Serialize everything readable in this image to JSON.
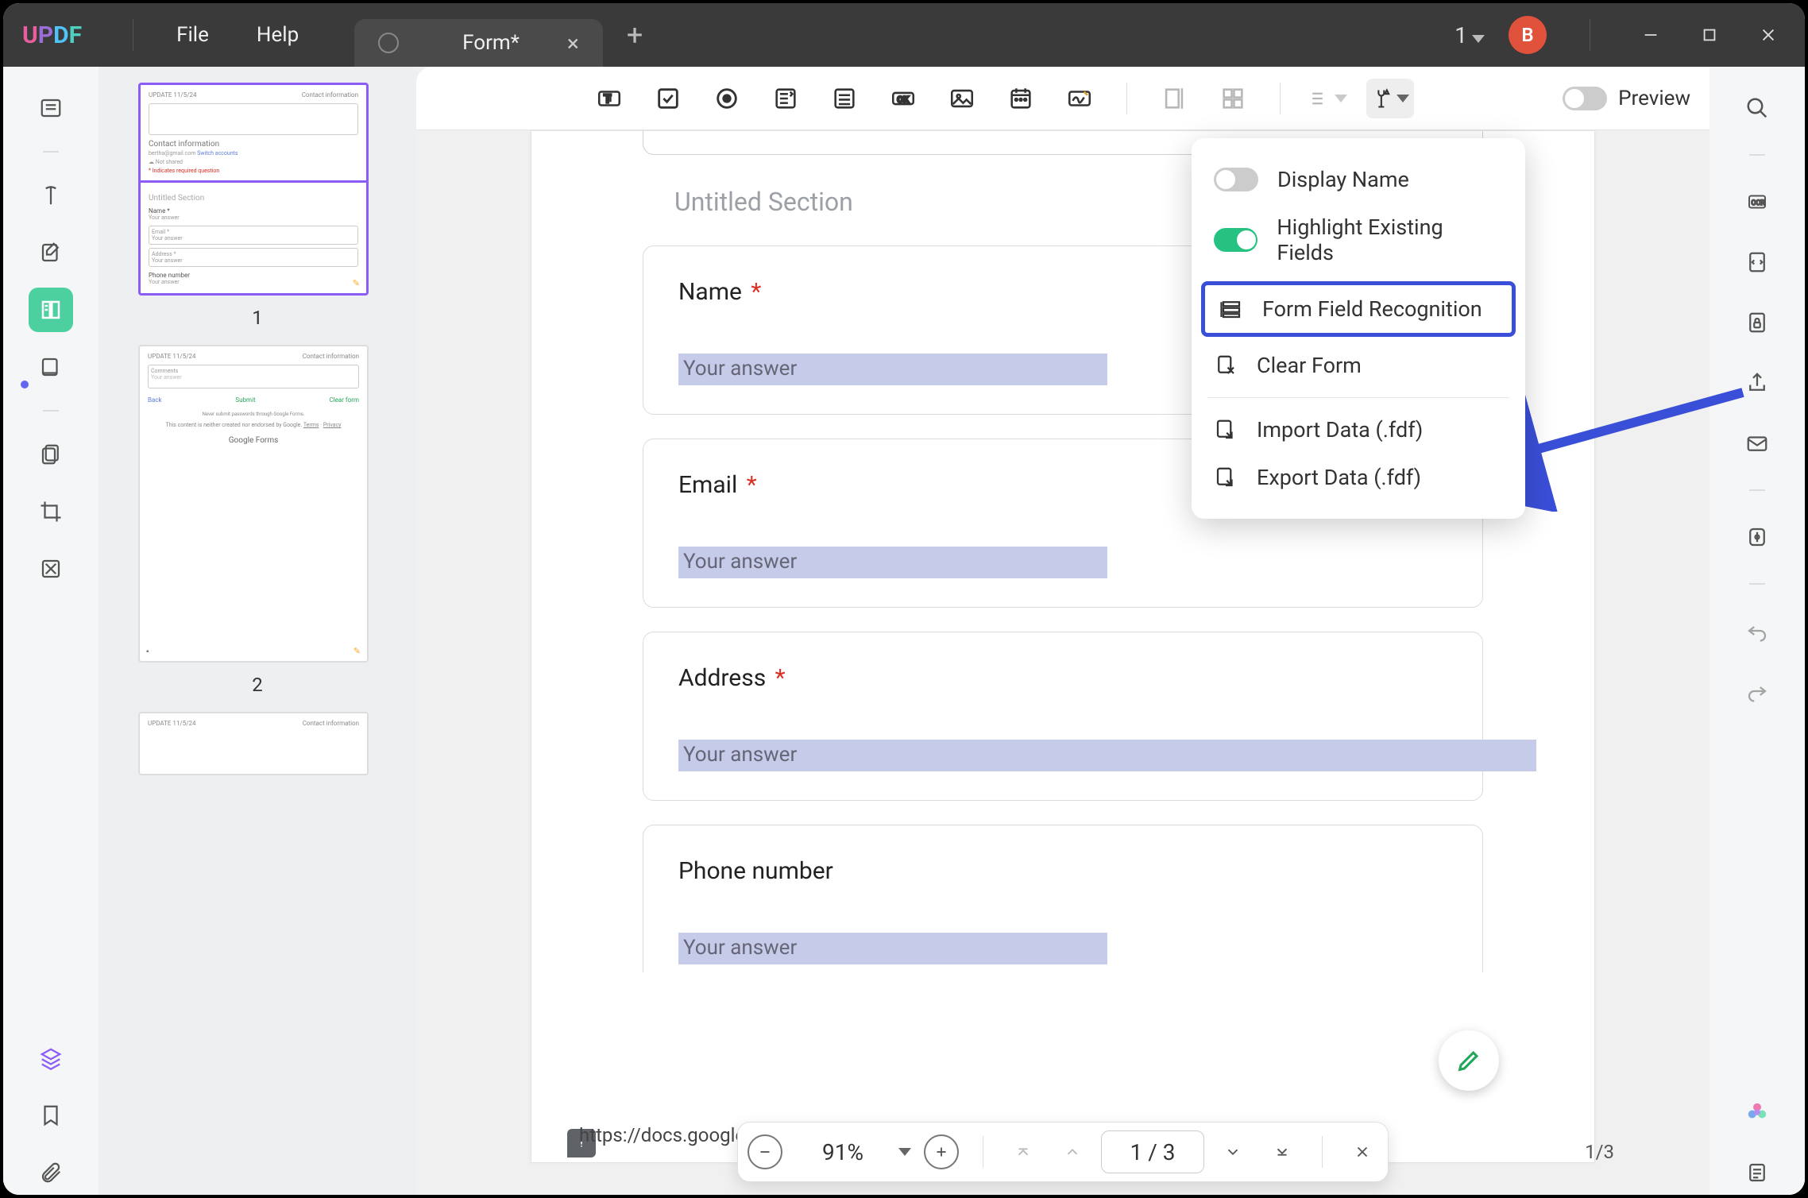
{
  "titlebar": {
    "logo": "UPDF",
    "file": "File",
    "help": "Help",
    "tab_name": "Form*",
    "window_count": "1",
    "avatar_initial": "B"
  },
  "form_toolbar": {
    "preview_label": "Preview"
  },
  "dropdown": {
    "display_name": "Display Name",
    "highlight_fields": "Highlight Existing Fields",
    "form_recognition": "Form Field Recognition",
    "clear_form": "Clear Form",
    "import_data": "Import Data (.fdf)",
    "export_data": "Export Data (.fdf)"
  },
  "thumbs": {
    "p1": "1",
    "p2": "2",
    "contact_info": "Contact information",
    "untitled": "Untitled Section",
    "forms": "Google Forms"
  },
  "doc": {
    "section_title": "Untitled Section",
    "q_name": "Name",
    "q_email": "Email",
    "q_address": "Address",
    "q_phone": "Phone number",
    "ans_placeholder": "Your answer",
    "req": "*"
  },
  "footer": {
    "url": "https://docs.google.com/forms/",
    "zoom": "91%",
    "page": "1 / 3",
    "counter": "1/3"
  }
}
